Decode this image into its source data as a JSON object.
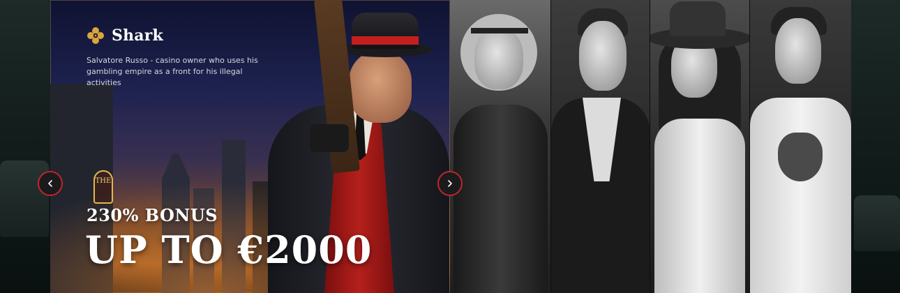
{
  "slide": {
    "character_name": "Shark",
    "description": "Salvatore Russo - casino owner who uses his gambling empire as a front for his illegal activities",
    "bonus_percent": "230% BONUS",
    "bonus_amount": "UP TO €2000",
    "sign_text": "THE"
  },
  "icons": {
    "character_icon": "gold-flower-icon",
    "prev": "chevron-left-icon",
    "next": "chevron-right-icon"
  },
  "colors": {
    "accent_red": "#c0262a",
    "icon_gold": "#d9a441"
  }
}
